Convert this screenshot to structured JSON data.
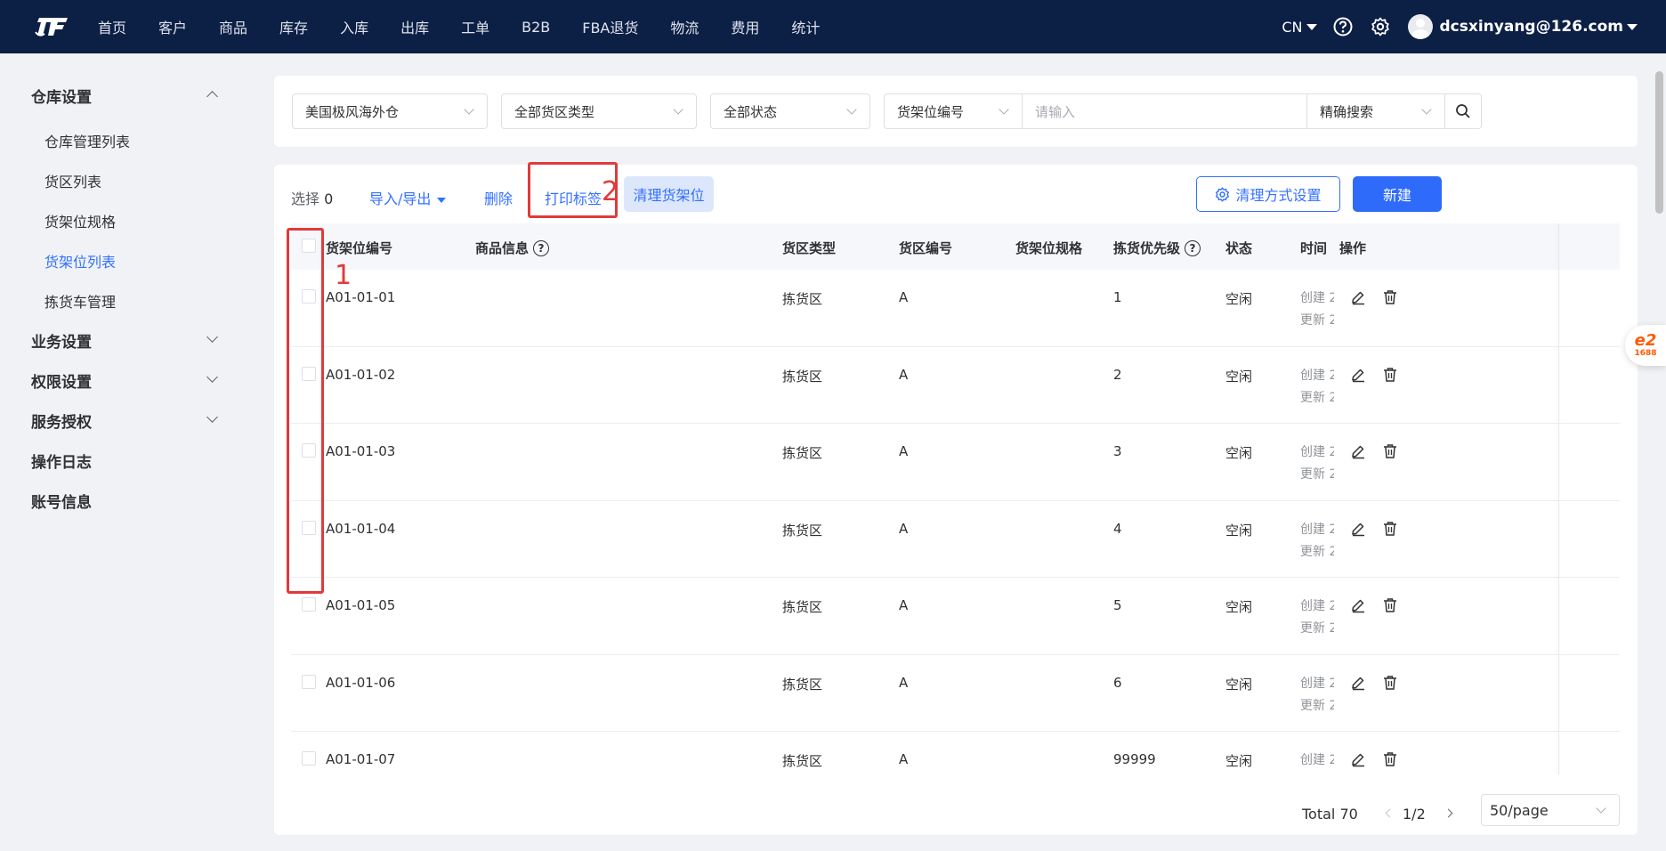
{
  "nav": {
    "items": [
      "首页",
      "客户",
      "商品",
      "库存",
      "入库",
      "出库",
      "工单",
      "B2B",
      "FBA退货",
      "物流",
      "费用",
      "统计"
    ],
    "lang": "CN",
    "user_email": "dcsxinyang@126.com"
  },
  "sidebar": {
    "group_warehouse": "仓库设置",
    "items": [
      "仓库管理列表",
      "货区列表",
      "货架位规格",
      "货架位列表",
      "拣货车管理"
    ],
    "active_item": "货架位列表",
    "group_business": "业务设置",
    "group_permission": "权限设置",
    "group_service": "服务授权",
    "group_log": "操作日志",
    "group_account": "账号信息"
  },
  "filters": {
    "warehouse": "美国极风海外仓",
    "area_type": "全部货区类型",
    "status": "全部状态",
    "search_field": "货架位编号",
    "search_placeholder": "请输入",
    "search_mode": "精确搜索"
  },
  "toolbar": {
    "select_label": "选择",
    "select_count": "0",
    "import_export": "导入/导出",
    "delete": "删除",
    "print_label": "打印标签",
    "clear_shelf": "清理货架位",
    "clear_settings": "清理方式设置",
    "new": "新建"
  },
  "table": {
    "headers": {
      "shelf_no": "货架位编号",
      "product_info": "商品信息",
      "area_type": "货区类型",
      "area_no": "货区编号",
      "shelf_spec": "货架位规格",
      "pick_priority": "拣货优先级",
      "status": "状态",
      "time": "时间",
      "ops": "操作"
    },
    "time_labels": {
      "created": "创建 2",
      "updated": "更新 2"
    },
    "rows": [
      {
        "shelf_no": "A01-01-01",
        "area_type": "拣货区",
        "area_no": "A",
        "priority": "1",
        "status": "空闲"
      },
      {
        "shelf_no": "A01-01-02",
        "area_type": "拣货区",
        "area_no": "A",
        "priority": "2",
        "status": "空闲"
      },
      {
        "shelf_no": "A01-01-03",
        "area_type": "拣货区",
        "area_no": "A",
        "priority": "3",
        "status": "空闲"
      },
      {
        "shelf_no": "A01-01-04",
        "area_type": "拣货区",
        "area_no": "A",
        "priority": "4",
        "status": "空闲"
      },
      {
        "shelf_no": "A01-01-05",
        "area_type": "拣货区",
        "area_no": "A",
        "priority": "5",
        "status": "空闲"
      },
      {
        "shelf_no": "A01-01-06",
        "area_type": "拣货区",
        "area_no": "A",
        "priority": "6",
        "status": "空闲"
      },
      {
        "shelf_no": "A01-01-07",
        "area_type": "拣货区",
        "area_no": "A",
        "priority": "99999",
        "status": "空闲"
      }
    ]
  },
  "pagination": {
    "total": "Total 70",
    "page": "1/2",
    "page_size": "50/page"
  },
  "annotations": {
    "marker_1": "1",
    "marker_2": "2"
  },
  "float_widget": {
    "top": "e2",
    "sub": "1688"
  },
  "colors": {
    "nav_bg": "#0c1f45",
    "primary": "#2f6bfa",
    "annotation": "#e03a3a"
  }
}
